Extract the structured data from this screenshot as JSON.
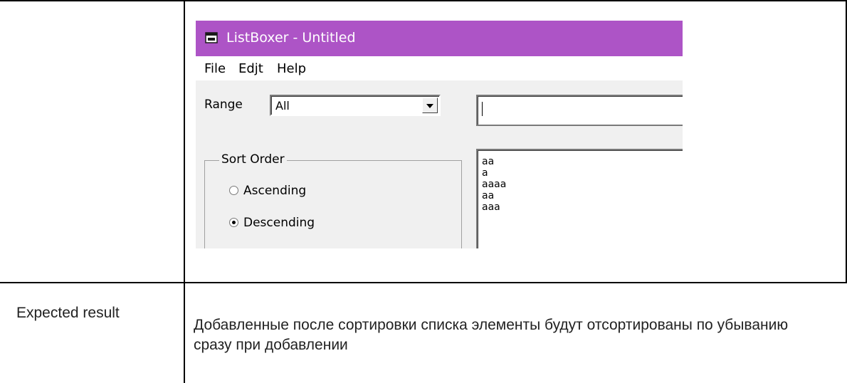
{
  "table": {
    "row2_label": "Expected result",
    "row2_text": "Добавленные после сортировки списка элементы будут отсортированы по убыванию сразу при добавлении"
  },
  "app": {
    "title": "ListBoxer - Untitled",
    "menu": [
      "File",
      "Edjt",
      "Help"
    ],
    "range_label": "Range",
    "range_value": "All",
    "edit_value": "",
    "sort_group_title": "Sort Order",
    "radios": [
      {
        "label": "Ascending",
        "selected": false
      },
      {
        "label": "Descending",
        "selected": true
      }
    ],
    "list_items": [
      "aa",
      "a",
      "aaaa",
      "aa",
      "aaa"
    ],
    "icons": {
      "app": "app-window-icon",
      "combo_arrow": "chevron-down-icon"
    },
    "colors": {
      "titlebar": "#ad54c6"
    }
  }
}
